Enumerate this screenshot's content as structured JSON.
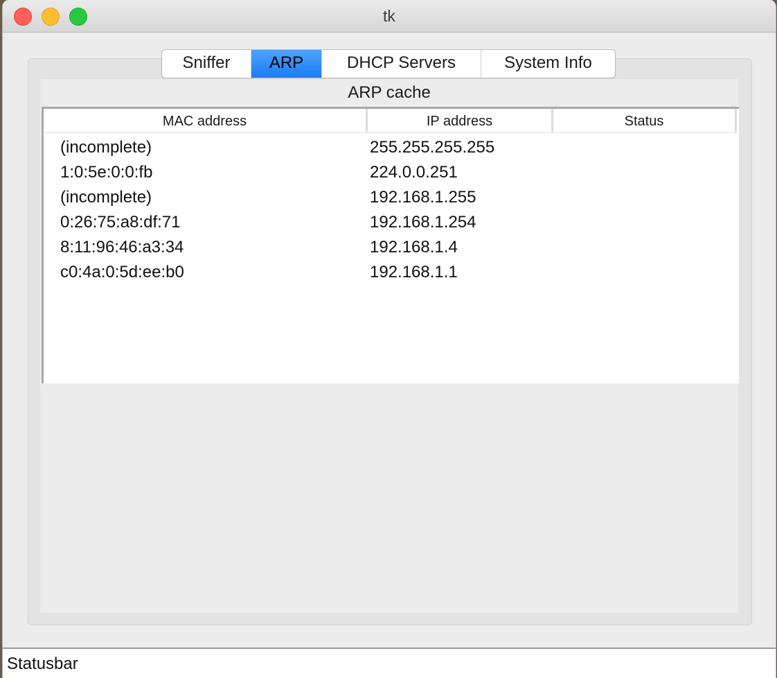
{
  "window": {
    "title": "tk"
  },
  "tabs": [
    {
      "label": "Sniffer",
      "active": false
    },
    {
      "label": "ARP",
      "active": true
    },
    {
      "label": "DHCP Servers",
      "active": false
    },
    {
      "label": "System Info",
      "active": false
    }
  ],
  "arp": {
    "section_title": "ARP cache",
    "columns": {
      "mac": "MAC address",
      "ip": "IP address",
      "status": "Status"
    },
    "rows": [
      {
        "mac": "(incomplete)",
        "ip": "255.255.255.255",
        "status": ""
      },
      {
        "mac": "1:0:5e:0:0:fb",
        "ip": "224.0.0.251",
        "status": ""
      },
      {
        "mac": "(incomplete)",
        "ip": "192.168.1.255",
        "status": ""
      },
      {
        "mac": "0:26:75:a8:df:71",
        "ip": "192.168.1.254",
        "status": ""
      },
      {
        "mac": "8:11:96:46:a3:34",
        "ip": "192.168.1.4",
        "status": ""
      },
      {
        "mac": "c0:4a:0:5d:ee:b0",
        "ip": "192.168.1.1",
        "status": ""
      }
    ]
  },
  "statusbar": {
    "text": "Statusbar"
  },
  "colors": {
    "accent": "#1a7cf2",
    "close": "#fe5f57",
    "minimize": "#febc2e",
    "maximize": "#28c840"
  }
}
